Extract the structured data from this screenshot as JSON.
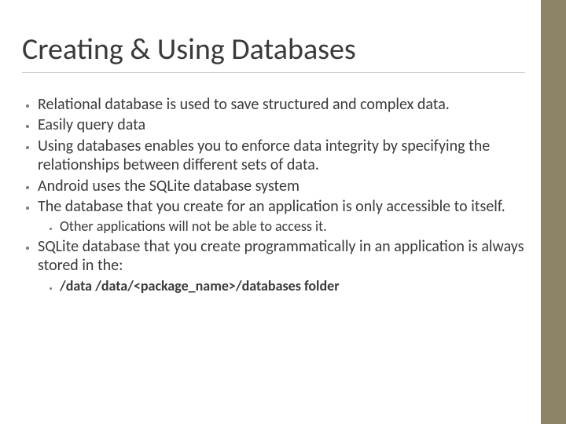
{
  "title": "Creating & Using Databases",
  "bullets": {
    "b0": "Relational database is used to save structured and complex data.",
    "b1": "Easily query data",
    "b2": "Using databases enables you to enforce data integrity by specifying the relationships between different sets of data.",
    "b3": "Android uses the SQLite database system",
    "b4": "The database that you create for an application is only accessible to itself.",
    "b4_sub0": "Other applications will not be able to access it.",
    "b5": "SQLite database that you create programmatically in an application is always stored in the:",
    "b5_sub0": "/data /data/<package_name>/databases folder"
  }
}
